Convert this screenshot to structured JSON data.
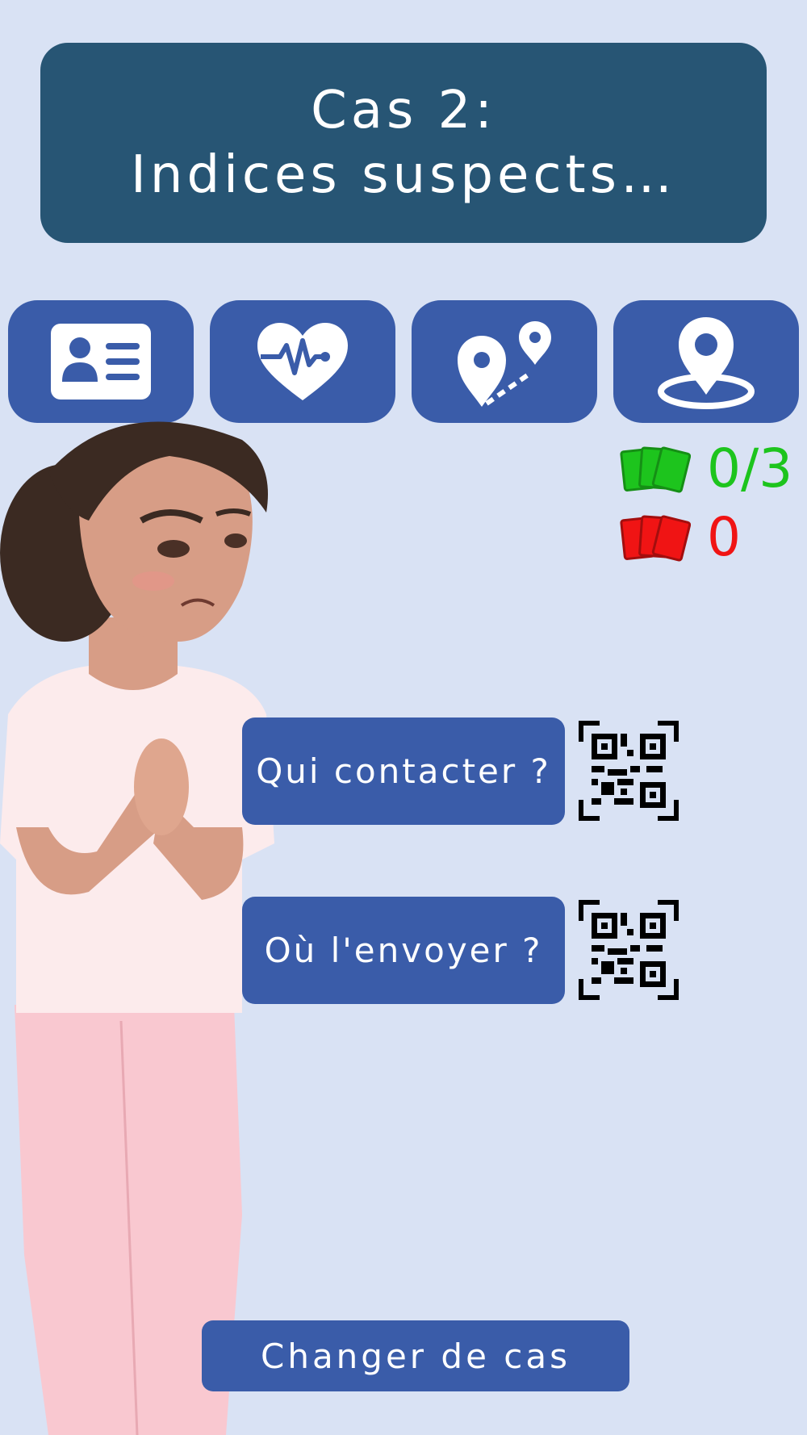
{
  "header": {
    "line1": "Cas 2:",
    "line2": "Indices suspects…"
  },
  "tabs": [
    {
      "icon": "id-card-icon"
    },
    {
      "icon": "heart-pulse-icon"
    },
    {
      "icon": "route-pins-icon"
    },
    {
      "icon": "location-pin-icon"
    }
  ],
  "counters": {
    "correct": {
      "value": "0/3",
      "color": "#1dc41d",
      "icon": "green-cards-icon"
    },
    "wrong": {
      "value": "0",
      "color": "#f01414",
      "icon": "red-cards-icon"
    }
  },
  "actions": [
    {
      "label": "Qui contacter ?",
      "qr_icon": "qr-code-icon"
    },
    {
      "label": "Où l'envoyer ?",
      "qr_icon": "qr-code-icon"
    }
  ],
  "footer": {
    "change_case_label": "Changer de cas"
  },
  "colors": {
    "background": "#d9e2f4",
    "header": "#275574",
    "button": "#3a5ca9"
  }
}
